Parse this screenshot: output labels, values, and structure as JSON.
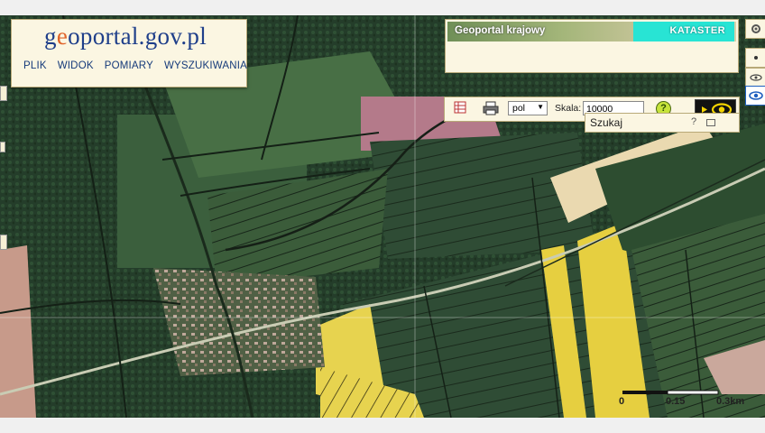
{
  "app": {
    "logo": {
      "prefix": "g",
      "accent": "e",
      "rest": "oportal.gov.pl"
    },
    "menu": [
      "PLIK",
      "WIDOK",
      "POMIARY",
      "WYSZUKIWANIA"
    ]
  },
  "layers": {
    "title": "Geoportal krajowy",
    "active_layer": "KATASTER"
  },
  "toolbar": {
    "language": "pol",
    "scale_label": "Skala:",
    "scale_value": "10000",
    "help": "?"
  },
  "search": {
    "label": "Szukaj",
    "help": "?"
  },
  "scalebar": {
    "start": "0",
    "mid": "0.15",
    "end": "0.3km"
  },
  "icons": {
    "print": "print-icon",
    "grid": "grid-icon",
    "eye": "eye-icon",
    "help": "help-icon",
    "maximize": "maximize-icon"
  },
  "colors": {
    "panel": "#fbf6e2",
    "menu_text": "#153a7a",
    "kataster": "#28e4d4",
    "help": "#c6e33b"
  }
}
